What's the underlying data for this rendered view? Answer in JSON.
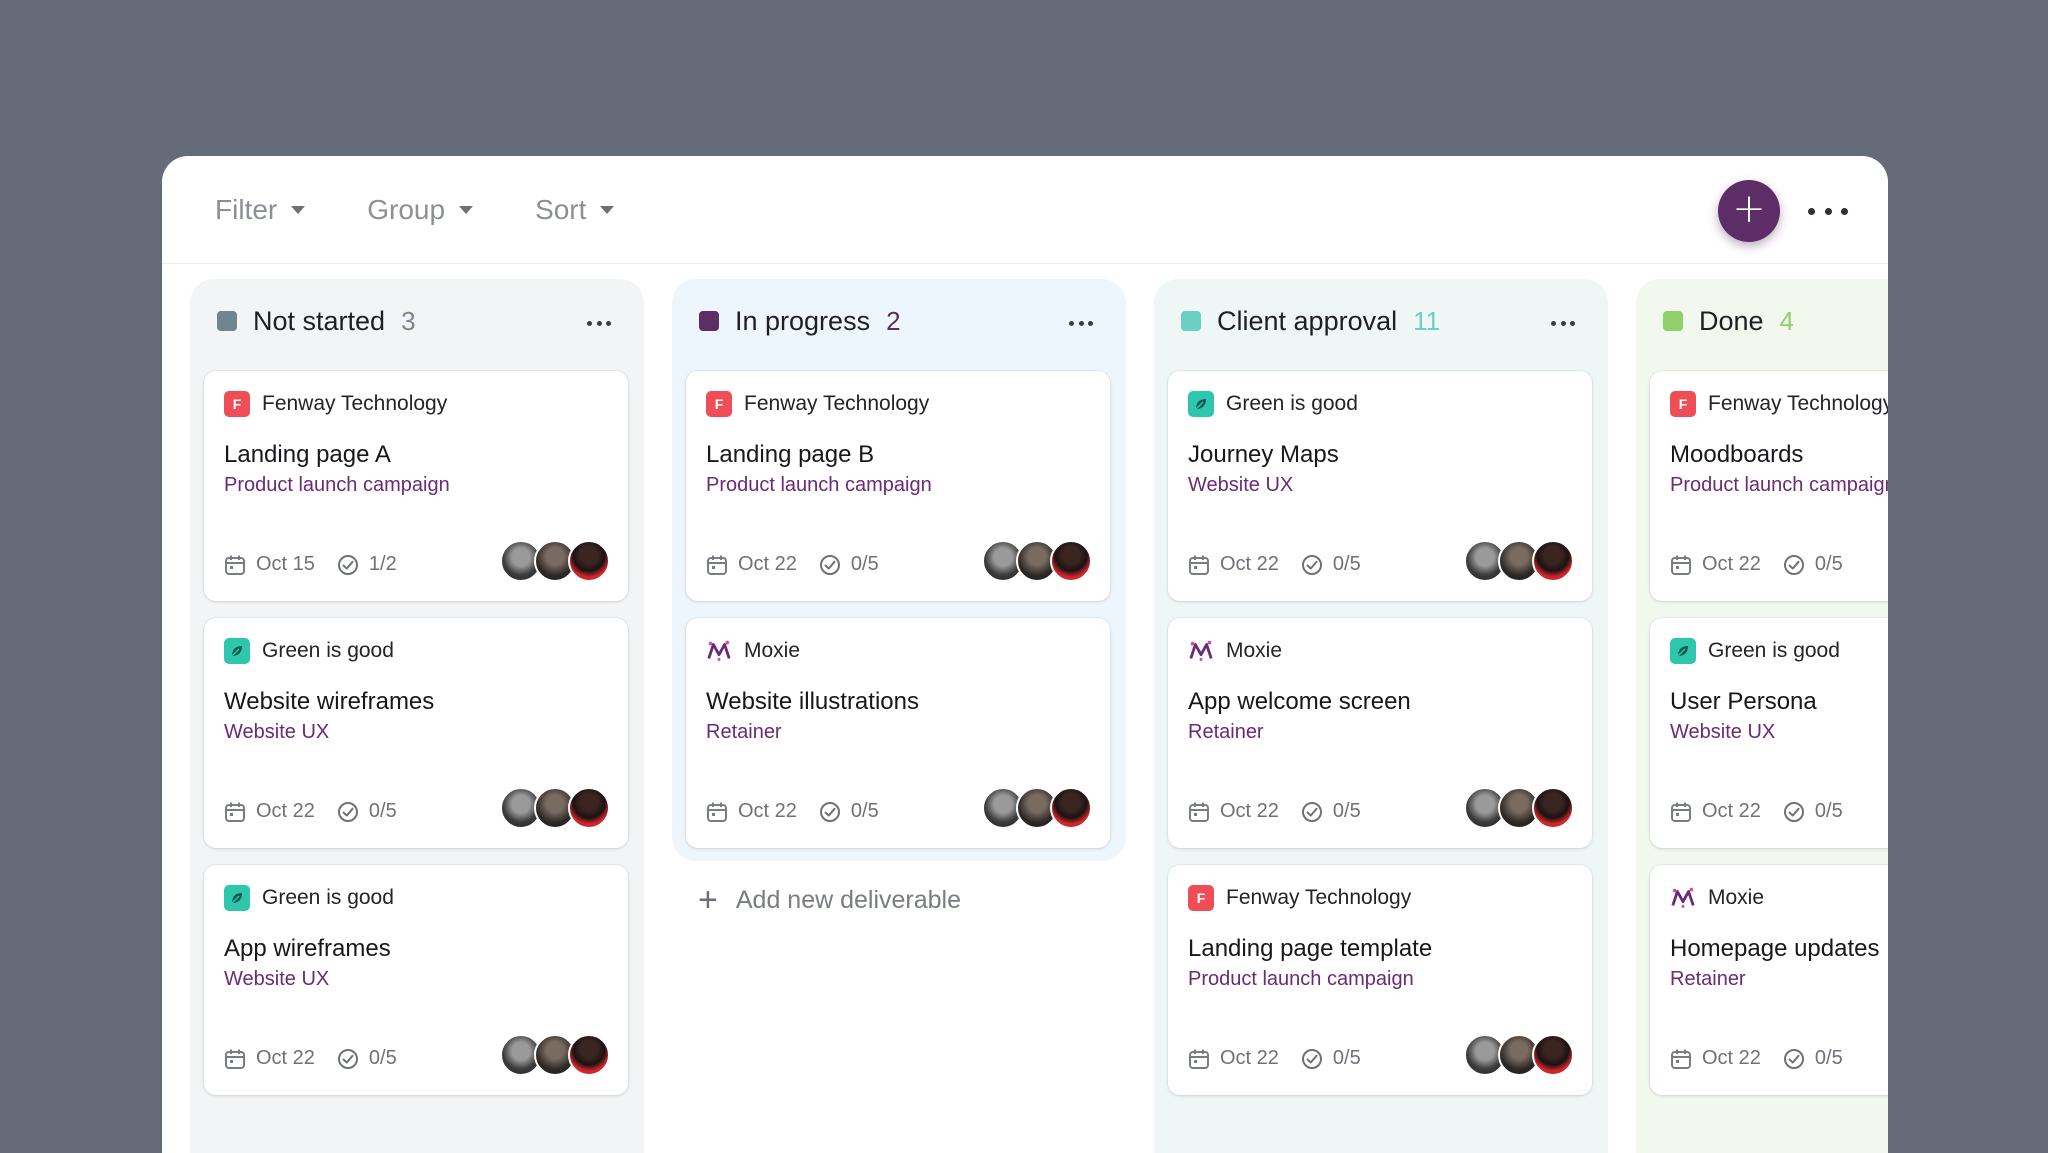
{
  "toolbar": {
    "filter_label": "Filter",
    "group_label": "Group",
    "sort_label": "Sort"
  },
  "columns": [
    {
      "title": "Not started",
      "count": "3",
      "swatch": "#6f8590",
      "count_color": "#7a8590",
      "bg": "#f3f4f6",
      "cards": [
        {
          "client": "Fenway Technology",
          "logo": "fenway",
          "title": "Landing page A",
          "sub": "Product launch campaign",
          "date": "Oct 15",
          "tasks": "1/2"
        },
        {
          "client": "Green is good",
          "logo": "green",
          "title": "Website wireframes",
          "sub": "Website UX",
          "date": "Oct 22",
          "tasks": "0/5"
        },
        {
          "client": "Green is good",
          "logo": "green",
          "title": "App wireframes",
          "sub": "Website UX",
          "date": "Oct 22",
          "tasks": "0/5"
        }
      ]
    },
    {
      "title": "In progress",
      "count": "2",
      "swatch": "#5b2f66",
      "count_color": "#5b2f66",
      "bg": "#edf6fc",
      "add_label": "Add new deliverable",
      "cards": [
        {
          "client": "Fenway Technology",
          "logo": "fenway",
          "title": "Landing page B",
          "sub": "Product launch campaign",
          "date": "Oct 22",
          "tasks": "0/5"
        },
        {
          "client": "Moxie",
          "logo": "moxie",
          "title": "Website illustrations",
          "sub": "Retainer",
          "date": "Oct 22",
          "tasks": "0/5"
        }
      ]
    },
    {
      "title": "Client approval",
      "count": "11",
      "swatch": "#6dcfc4",
      "count_color": "#6dcfc4",
      "bg": "#eef6f6",
      "cards": [
        {
          "client": "Green is good",
          "logo": "green",
          "title": "Journey Maps",
          "sub": "Website UX",
          "date": "Oct 22",
          "tasks": "0/5"
        },
        {
          "client": "Moxie",
          "logo": "moxie",
          "title": "App welcome screen",
          "sub": "Retainer",
          "date": "Oct 22",
          "tasks": "0/5"
        },
        {
          "client": "Fenway Technology",
          "logo": "fenway",
          "title": "Landing page template",
          "sub": "Product launch campaign",
          "date": "Oct 22",
          "tasks": "0/5"
        }
      ]
    },
    {
      "title": "Done",
      "count": "4",
      "swatch": "#8fcf6c",
      "count_color": "#8fcf6c",
      "bg": "#f2f8ee",
      "cards": [
        {
          "client": "Fenway Technology",
          "logo": "fenway",
          "title": "Moodboards",
          "sub": "Product launch campaign",
          "date": "Oct 22",
          "tasks": "0/5"
        },
        {
          "client": "Green is good",
          "logo": "green",
          "title": "User Persona",
          "sub": "Website UX",
          "date": "Oct 22",
          "tasks": "0/5"
        },
        {
          "client": "Moxie",
          "logo": "moxie",
          "title": "Homepage updates",
          "sub": "Retainer",
          "date": "Oct 22",
          "tasks": "0/5"
        }
      ]
    }
  ],
  "icons": {
    "add": "plus-icon",
    "more": "more-horizontal-icon",
    "date": "calendar-icon",
    "tasks": "check-circle-icon"
  },
  "colors": {
    "accent": "#5c2d66",
    "link": "#6a2a77",
    "fenway": "#f04e56",
    "green": "#2ec7ad"
  }
}
